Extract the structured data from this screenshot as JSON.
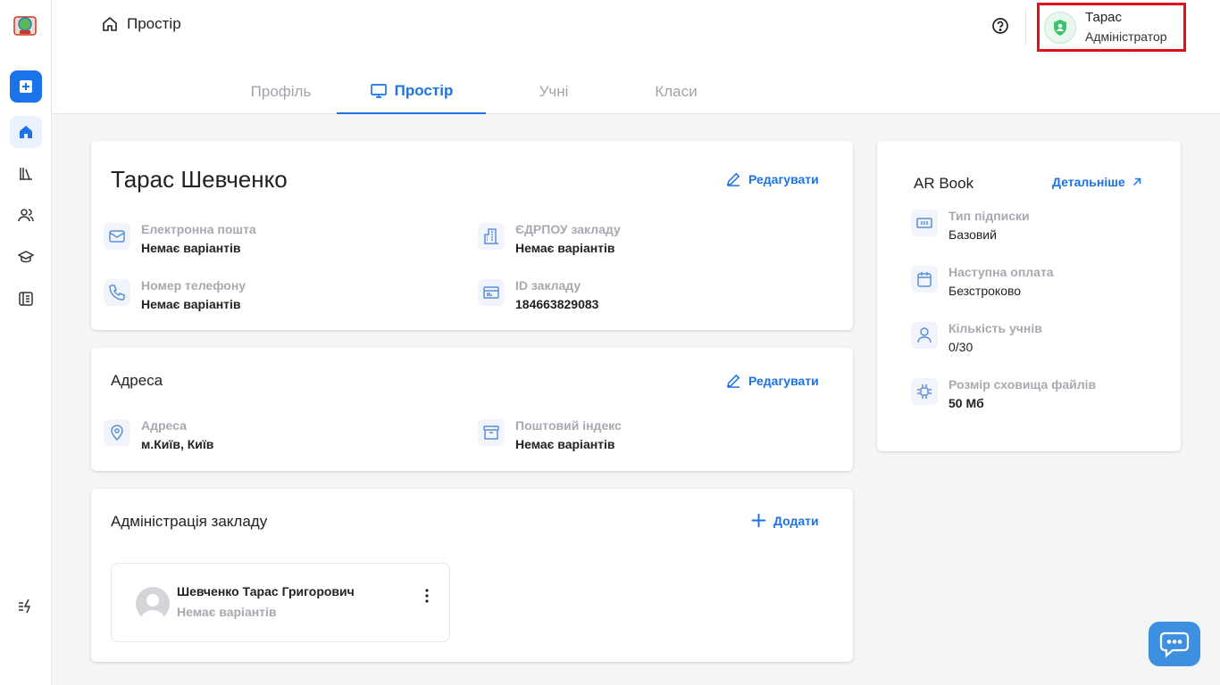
{
  "sidebar": {
    "items": [
      {
        "icon": "add-icon"
      },
      {
        "icon": "home-icon"
      },
      {
        "icon": "library-icon"
      },
      {
        "icon": "users-icon"
      },
      {
        "icon": "graduation-cap-icon"
      },
      {
        "icon": "journal-icon"
      },
      {
        "icon": "quick-actions-icon"
      }
    ]
  },
  "header": {
    "breadcrumb": "Простір",
    "user": {
      "name": "Тарас",
      "role": "Адміністратор"
    }
  },
  "tabs": [
    {
      "label": "Профіль",
      "active": false
    },
    {
      "label": "Простір",
      "active": true
    },
    {
      "label": "Учні",
      "active": false
    },
    {
      "label": "Класи",
      "active": false
    }
  ],
  "profile": {
    "name": "Тарас Шевченко",
    "edit_label": "Редагувати",
    "fields": [
      {
        "label": "Електронна пошта",
        "value": "Немає варіантів",
        "icon": "mail-icon"
      },
      {
        "label": "ЄДРПОУ закладу",
        "value": "Немає варіантів",
        "icon": "building-icon"
      },
      {
        "label": "Номер телефону",
        "value": "Немає варіантів",
        "icon": "phone-icon"
      },
      {
        "label": "ID закладу",
        "value": "184663829083",
        "icon": "id-card-icon"
      }
    ]
  },
  "address": {
    "title": "Адреса",
    "edit_label": "Редагувати",
    "fields": [
      {
        "label": "Адреса",
        "value": "м.Київ, Київ",
        "icon": "location-pin-icon"
      },
      {
        "label": "Поштовий індекс",
        "value": "Немає варіантів",
        "icon": "archive-box-icon"
      }
    ]
  },
  "administration": {
    "title": "Адміністрація закладу",
    "add_label": "Додати",
    "members": [
      {
        "name": "Шевченко Тарас Григорович",
        "sub": "Немає варіантів"
      }
    ]
  },
  "subscription": {
    "title": "AR Book",
    "details_label": "Детальніше",
    "fields": [
      {
        "label": "Тип підписки",
        "value": "Базовий",
        "icon": "ticket-icon"
      },
      {
        "label": "Наступна оплата",
        "value": "Безстроково",
        "icon": "calendar-icon"
      },
      {
        "label": "Кількість учнів",
        "value": "0/30",
        "icon": "user-icon"
      },
      {
        "label": "Розмір сховища файлів",
        "value": "50 Мб",
        "icon": "chip-icon"
      }
    ]
  },
  "colors": {
    "accent": "#1a73e8",
    "highlight": "#e0101b",
    "chat": "#3d8fe0"
  }
}
